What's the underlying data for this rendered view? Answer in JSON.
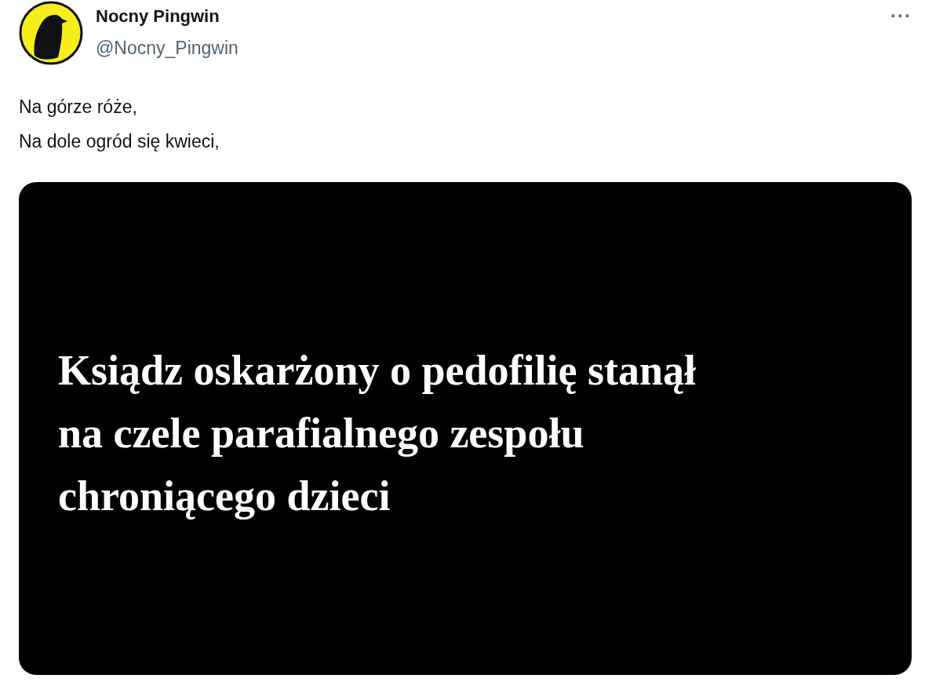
{
  "author": {
    "name": "Nocny Pingwin",
    "handle": "@Nocny_Pingwin"
  },
  "more_button": "···",
  "text_lines": [
    "Na górze róże,",
    "Na dole ogród się kwieci,"
  ],
  "media": {
    "kind": "headline-card",
    "headline_lines": [
      "Ksiądz oskarżony o pedofilię stanął",
      "na czele parafialnego zespołu",
      "chroniącego dzieci"
    ]
  }
}
